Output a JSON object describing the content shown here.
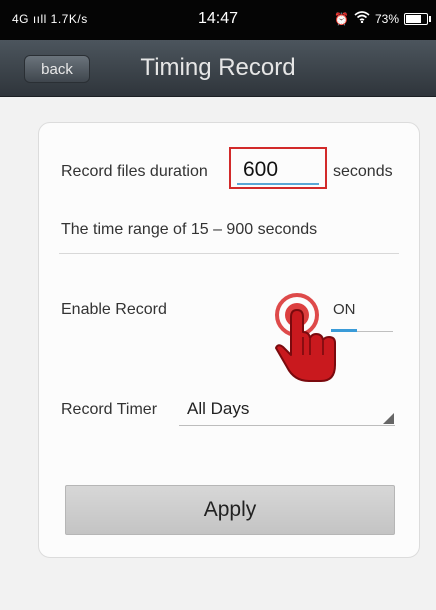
{
  "status_bar": {
    "left": "4G ııll 1.7K/s",
    "time": "14:47",
    "battery": "73%"
  },
  "header": {
    "back_label": "back",
    "title": "Timing Record"
  },
  "form": {
    "duration_label": "Record files duration",
    "duration_value": "600",
    "duration_unit": "seconds",
    "range_text": "The time range of 15 – 900 seconds",
    "enable_label": "Enable Record",
    "enable_state": "ON",
    "timer_label": "Record Timer",
    "timer_value": "All Days",
    "apply_label": "Apply"
  },
  "colors": {
    "highlight": "#d22a2a",
    "accent": "#3a9bd8",
    "header_bg": "#3d444a"
  }
}
